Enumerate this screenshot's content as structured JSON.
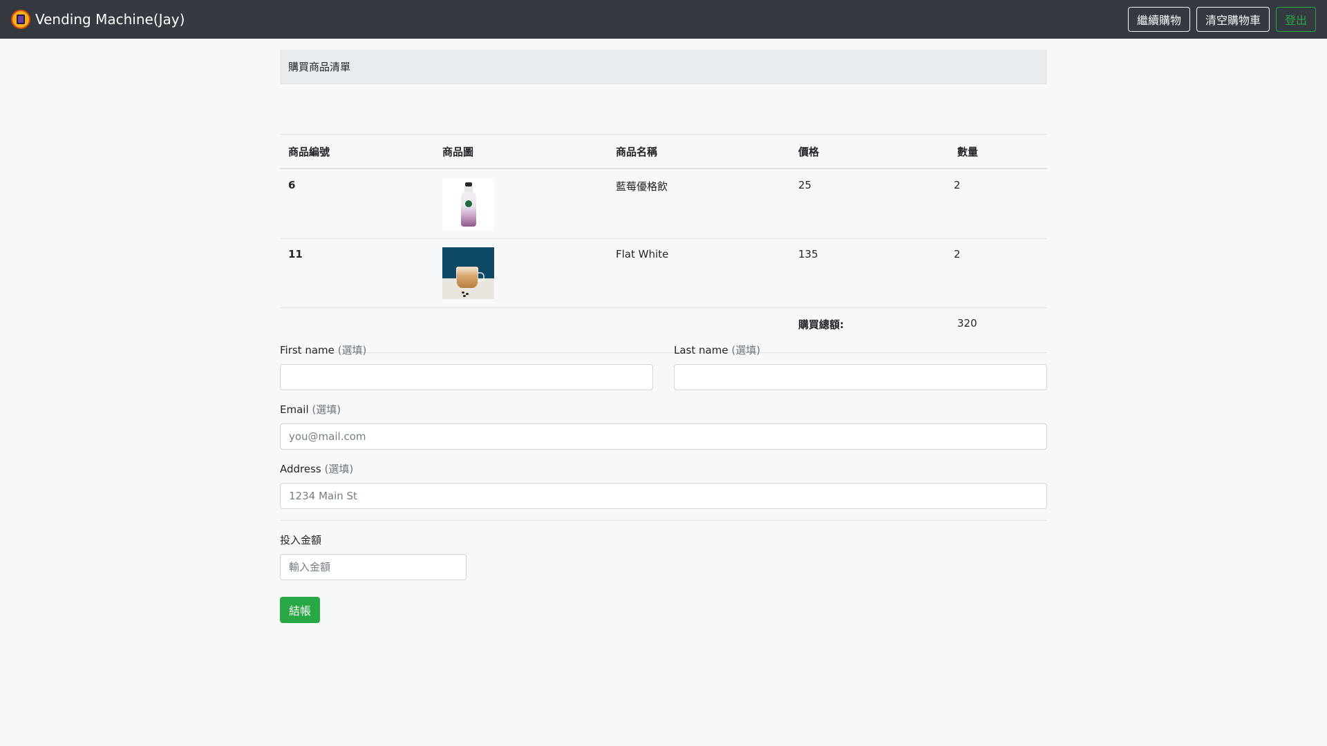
{
  "app": {
    "brand_title": "Vending Machine(Jay)",
    "logo_icon": "vending-machine-logo-icon"
  },
  "nav": {
    "continue_label": "繼續購物",
    "clear_label": "清空購物車",
    "logout_label": "登出"
  },
  "cart": {
    "header": "購買商品清單",
    "columns": {
      "id": "商品編號",
      "image": "商品圖",
      "name": "商品名稱",
      "price": "價格",
      "qty": "數量"
    },
    "rows": [
      {
        "id": "6",
        "image": "milk-bottle-image",
        "name": "藍莓優格飲",
        "price": "25",
        "qty": "2"
      },
      {
        "id": "11",
        "image": "flat-white-coffee-image",
        "name": "Flat White",
        "price": "135",
        "qty": "2"
      }
    ],
    "total_label": "購買總額:",
    "total_value": "320"
  },
  "form": {
    "first_name_label": "First name",
    "last_name_label": "Last name",
    "email_label": "Email",
    "address_label": "Address",
    "optional_tag": "(選填)",
    "first_name_value": "",
    "last_name_value": "",
    "email_placeholder": "you@mail.com",
    "address_placeholder": "1234 Main St",
    "amount_label": "投入金額",
    "amount_placeholder": "輸入金額",
    "checkout_label": "結帳"
  },
  "colors": {
    "navbar": "#343a40",
    "success": "#28a745",
    "background": "#f7f8f9"
  }
}
